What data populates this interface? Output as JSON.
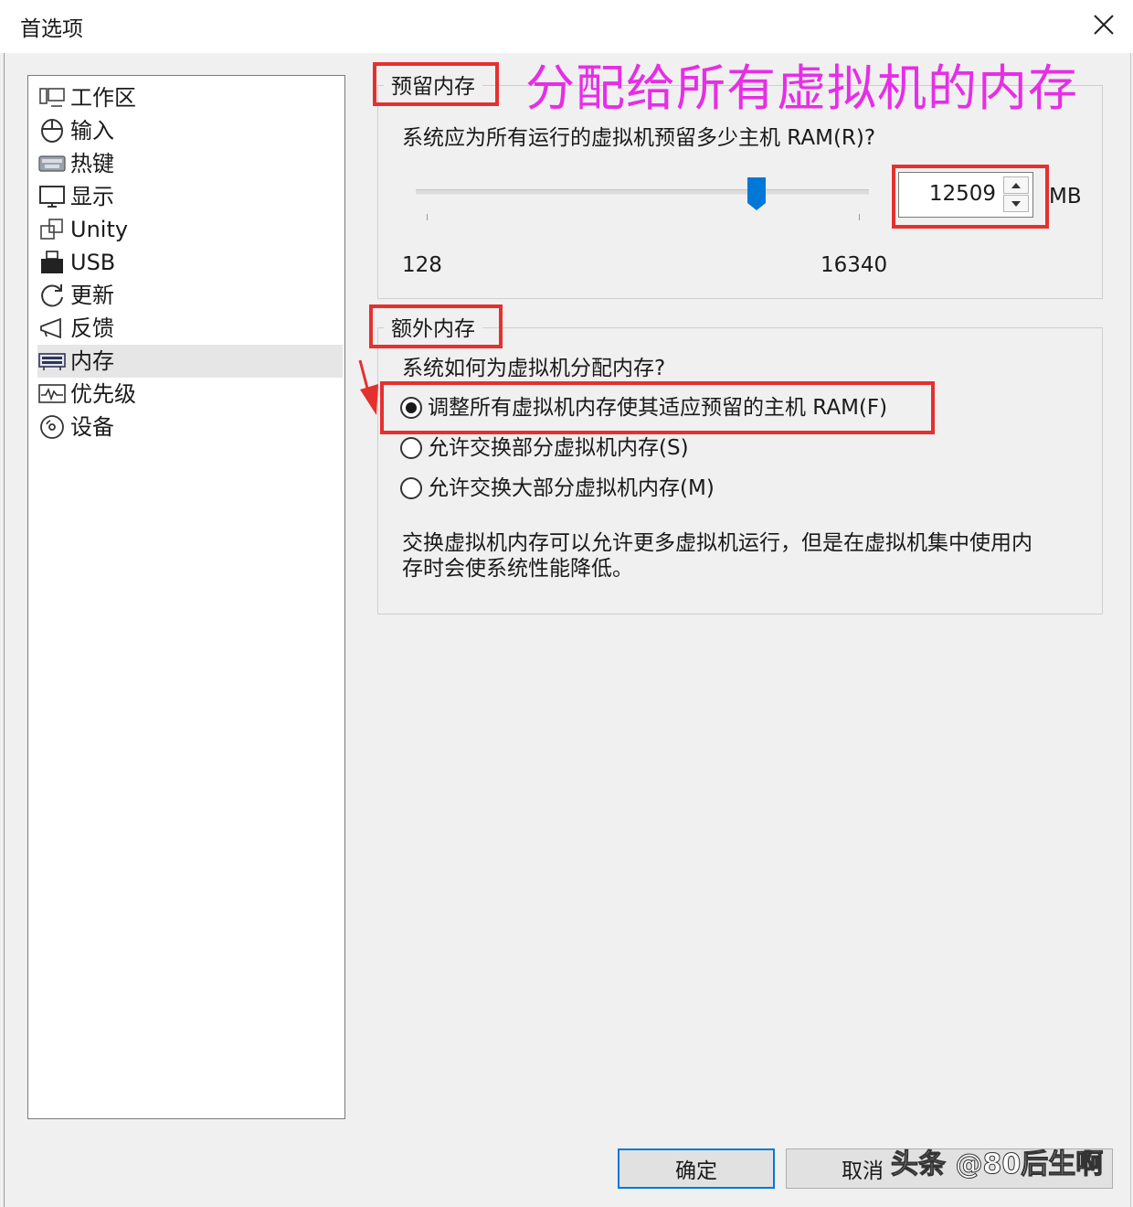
{
  "window": {
    "title": "首选项"
  },
  "sidebar": {
    "items": [
      {
        "label": "工作区",
        "icon": "workspace-icon"
      },
      {
        "label": "输入",
        "icon": "mouse-icon"
      },
      {
        "label": "热键",
        "icon": "keyboard-icon"
      },
      {
        "label": "显示",
        "icon": "monitor-icon"
      },
      {
        "label": "Unity",
        "icon": "unity-windows-icon"
      },
      {
        "label": "USB",
        "icon": "usb-icon"
      },
      {
        "label": "更新",
        "icon": "refresh-icon"
      },
      {
        "label": "反馈",
        "icon": "megaphone-icon"
      },
      {
        "label": "内存",
        "icon": "memory-icon",
        "selected": true
      },
      {
        "label": "优先级",
        "icon": "priority-graph-icon"
      },
      {
        "label": "设备",
        "icon": "disc-icon"
      }
    ]
  },
  "annotation": {
    "text": "分配给所有虚拟机的内存",
    "color": "#e62ee6"
  },
  "reserved_memory": {
    "legend": "预留内存",
    "question": "系统应为所有运行的虚拟机预留多少主机 RAM(R)?",
    "slider": {
      "min": 128,
      "max": 16340,
      "value": 12509,
      "min_label": "128",
      "max_label": "16340"
    },
    "value": "12509",
    "unit": "MB"
  },
  "extra_memory": {
    "legend": "额外内存",
    "question": "系统如何为虚拟机分配内存?",
    "options": [
      {
        "label": "调整所有虚拟机内存使其适应预留的主机 RAM(F)",
        "selected": true
      },
      {
        "label": "允许交换部分虚拟机内存(S)",
        "selected": false
      },
      {
        "label": "允许交换大部分虚拟机内存(M)",
        "selected": false
      }
    ],
    "description_line1": "交换虚拟机内存可以允许更多虚拟机运行，但是在虚拟机集中使用内",
    "description_line2": "存时会使系统性能降低。"
  },
  "buttons": {
    "ok": "确定",
    "cancel": "取消"
  },
  "watermark": "头条 @80后生啊",
  "colors": {
    "highlight_box": "#e53030",
    "accent": "#0078d7",
    "annotation": "#e62ee6"
  }
}
